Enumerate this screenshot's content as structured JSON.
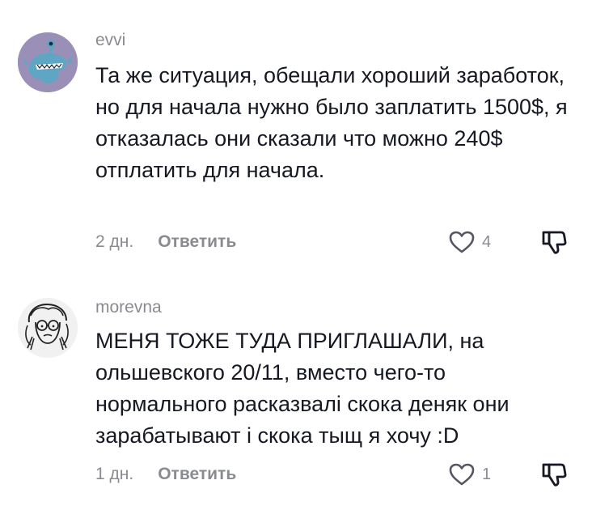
{
  "comments": [
    {
      "username": "evvi",
      "avatar_icon": "blue-monster-avatar",
      "text": "Та же ситуация, обещали хороший заработок, но для начала нужно было заплатить 1500$, я отказалась они сказали что можно 240$ отплатить для начала.",
      "time": "2 дн.",
      "reply_label": "Ответить",
      "like_count": "4",
      "like_icon": "heart-outline-icon",
      "dislike_icon": "thumbs-down-icon"
    },
    {
      "username": "morevna",
      "avatar_icon": "sketch-face-avatar",
      "text": "МЕНЯ ТОЖЕ ТУДА ПРИГЛАШАЛИ, на ольшевского 20/11, вместо чего-то нормального расказвалі скока деняк они зарабатывают і скока тыщ я хочу :D",
      "time": "1 дн.",
      "reply_label": "Ответить",
      "like_count": "1",
      "like_icon": "heart-outline-icon",
      "dislike_icon": "thumbs-down-icon"
    }
  ],
  "colors": {
    "text": "#161823",
    "secondary": "#8a8b91",
    "avatar1_bg": "#9a8fb6",
    "avatar2_bg": "#f1f1f1"
  }
}
